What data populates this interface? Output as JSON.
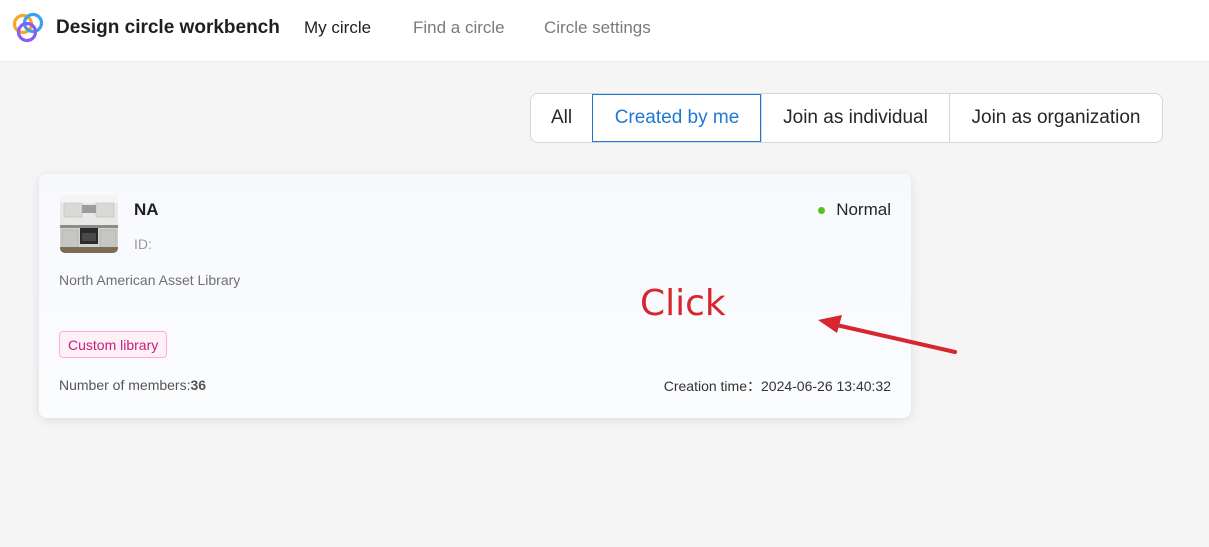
{
  "header": {
    "app_title": "Design circle workbench",
    "nav": [
      {
        "label": "My circle",
        "active": true
      },
      {
        "label": "Find a circle",
        "active": false
      },
      {
        "label": "Circle settings",
        "active": false
      }
    ]
  },
  "filters": {
    "options": [
      "All",
      "Created by me",
      "Join as individual",
      "Join as organization"
    ],
    "selected": "Created by me"
  },
  "card": {
    "name": "NA",
    "id_label": "ID:",
    "status": "Normal",
    "description": "North American Asset Library",
    "tag": "Custom library",
    "members_label": "Number of members:",
    "members_count": "36",
    "created_label": "Creation time：",
    "created_value": "2024-06-26 13:40:32"
  },
  "annotation": {
    "text": "Click"
  },
  "colors": {
    "accent": "#1e78d4",
    "status_green": "#52c41a",
    "tag_text": "#c41d7f",
    "annotation_red": "#d8262f"
  }
}
